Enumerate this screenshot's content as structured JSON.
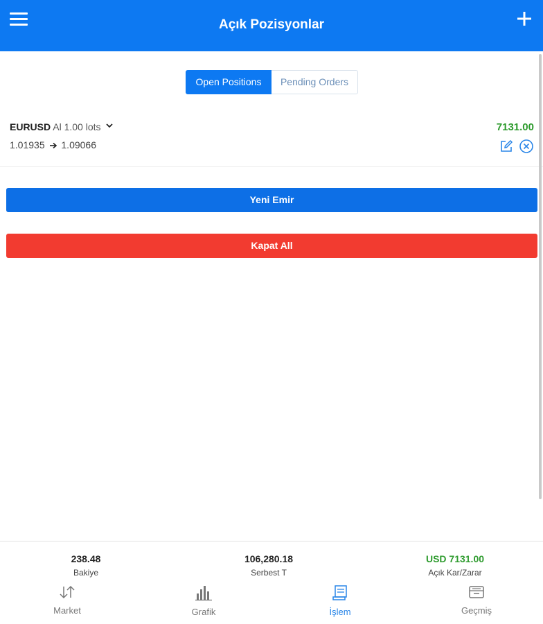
{
  "header": {
    "title": "Açık Pozisyonlar",
    "menu_icon": "hamburger-menu-icon",
    "add_icon": "plus-icon"
  },
  "tabs": [
    {
      "label": "Open Positions",
      "active": true
    },
    {
      "label": "Pending Orders",
      "active": false
    }
  ],
  "position": {
    "symbol": "EURUSD",
    "side": "Al",
    "lots": "1.00 lots",
    "open_price": "1.01935",
    "current_price": "1.09066",
    "profit": "7131.00",
    "edit_icon": "edit-icon",
    "close_icon": "close-circle-icon"
  },
  "actions": {
    "new_order": "Yeni Emir",
    "close_all": "Kapat All"
  },
  "summary": [
    {
      "value": "238.48",
      "label": "Bakiye"
    },
    {
      "value": "106,280.18",
      "label": "Serbest T"
    },
    {
      "value": "USD 7131.00",
      "label": "Açık Kar/Zarar"
    }
  ],
  "bottom_nav": [
    {
      "label": "Market",
      "icon": "arrows-up-down-icon",
      "active": false
    },
    {
      "label": "Grafik",
      "icon": "bar-chart-icon",
      "active": false
    },
    {
      "label": "İşlem",
      "icon": "receipt-icon",
      "active": true
    },
    {
      "label": "Geçmiş",
      "icon": "archive-icon",
      "active": false
    }
  ],
  "colors": {
    "primary": "#0d79f2",
    "danger": "#f23b30",
    "profit": "#2e9b2e",
    "active_nav": "#2a86e8"
  }
}
